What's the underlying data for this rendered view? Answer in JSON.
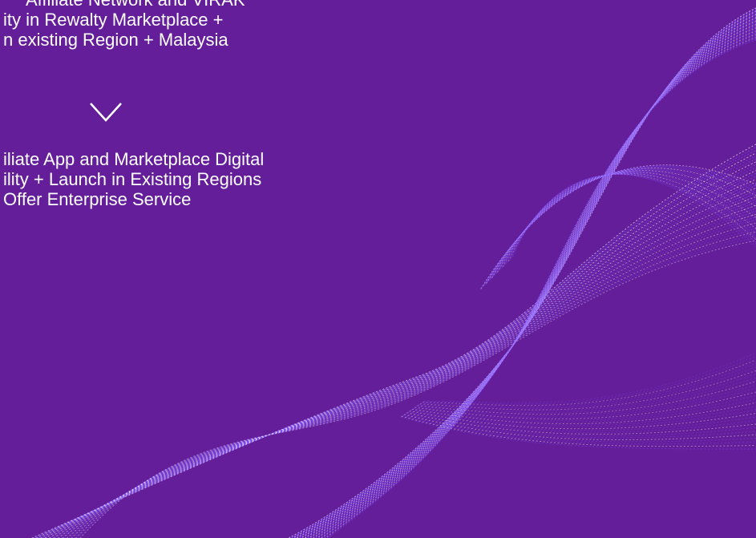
{
  "slide": {
    "background_color": "#651e9a",
    "wave_color": "#7f4dff",
    "wave_highlight": "#ffffff",
    "text_color": "#ffffff"
  },
  "upper_block": {
    "lines": [
      "Affiliate Network and VIRAK",
      "ity in Rewalty Marketplace +",
      "n existing Region + Malaysia"
    ]
  },
  "arrow": {
    "icon": "chevron-down-icon"
  },
  "lower_block": {
    "lines": [
      "iliate App and Marketplace Digital",
      "ility + Launch in Existing Regions",
      "Offer Enterprise Service"
    ]
  }
}
